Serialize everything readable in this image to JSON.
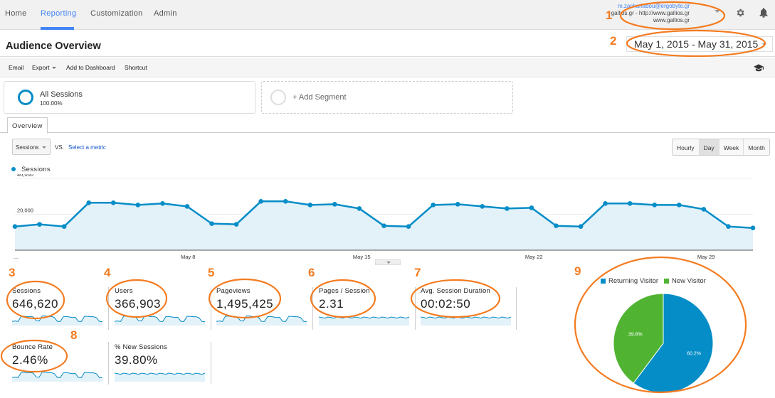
{
  "nav": {
    "tabs": [
      {
        "label": "Home",
        "active": false
      },
      {
        "label": "Reporting",
        "active": true
      },
      {
        "label": "Customization",
        "active": false
      },
      {
        "label": "Admin",
        "active": false
      }
    ],
    "account": {
      "email": "m.zachariadou@ergobyte.gr",
      "property": "gallios.gr - http://www.gallios.gr",
      "view": "www.gallios.gr"
    },
    "icons": [
      "gear-icon",
      "bell-icon"
    ]
  },
  "header": {
    "title": "Audience Overview",
    "date_range": "May 1, 2015 - May 31, 2015"
  },
  "toolbar": {
    "email": "Email",
    "export": "Export",
    "add_to_dashboard": "Add to Dashboard",
    "shortcut": "Shortcut"
  },
  "segments": {
    "all_label": "All Sessions",
    "all_pct": "100.00%",
    "add_label": "+ Add Segment"
  },
  "tabs": {
    "overview": "Overview"
  },
  "controls": {
    "metric": "Sessions",
    "vs": "VS.",
    "select_metric": "Select a metric",
    "granularity": [
      {
        "label": "Hourly",
        "active": false
      },
      {
        "label": "Day",
        "active": true
      },
      {
        "label": "Week",
        "active": false
      },
      {
        "label": "Month",
        "active": false
      }
    ]
  },
  "chart_data": [
    {
      "type": "area",
      "title": "",
      "legend": [
        "Sessions"
      ],
      "series_color": "#058dc7",
      "fill_color": "#e3f1f9",
      "ylim": [
        0,
        40000
      ],
      "yticks": [
        20000,
        40000
      ],
      "ytick_labels": [
        "20,000",
        "40,000"
      ],
      "xtick_labels": [
        {
          "index": 0,
          "label": "..."
        },
        {
          "index": 7,
          "label": "May 8"
        },
        {
          "index": 14,
          "label": "May 15"
        },
        {
          "index": 21,
          "label": "May 22"
        },
        {
          "index": 28,
          "label": "May 29"
        }
      ],
      "x": [
        "May 1",
        "May 2",
        "May 3",
        "May 4",
        "May 5",
        "May 6",
        "May 7",
        "May 8",
        "May 9",
        "May 10",
        "May 11",
        "May 12",
        "May 13",
        "May 14",
        "May 15",
        "May 16",
        "May 17",
        "May 18",
        "May 19",
        "May 20",
        "May 21",
        "May 22",
        "May 23",
        "May 24",
        "May 25",
        "May 26",
        "May 27",
        "May 28",
        "May 29",
        "May 30",
        "May 31"
      ],
      "series": [
        {
          "name": "Sessions",
          "values": [
            13200,
            14400,
            13200,
            26400,
            26400,
            25200,
            26000,
            24400,
            14800,
            14400,
            27200,
            27200,
            25200,
            25600,
            23200,
            13600,
            13200,
            25200,
            25600,
            24400,
            23200,
            23600,
            13600,
            13200,
            26000,
            26000,
            25200,
            25200,
            22800,
            13200,
            12400
          ]
        }
      ]
    },
    {
      "type": "pie",
      "legend": [
        "Returning Visitor",
        "New Visitor"
      ],
      "categories": [
        "Returning Visitor",
        "New Visitor"
      ],
      "values": [
        60.2,
        39.8
      ],
      "labels": [
        "60.2%",
        "39.8%"
      ],
      "colors": [
        "#058dc7",
        "#50b432"
      ]
    }
  ],
  "metrics": [
    {
      "label": "Sessions",
      "value": "646,620"
    },
    {
      "label": "Users",
      "value": "366,903"
    },
    {
      "label": "Pageviews",
      "value": "1,495,425"
    },
    {
      "label": "Pages / Session",
      "value": "2.31"
    },
    {
      "label": "Avg. Session Duration",
      "value": "00:02:50"
    },
    {
      "label": "Bounce Rate",
      "value": "2.46%"
    },
    {
      "label": "% New Sessions",
      "value": "39.80%"
    }
  ],
  "annotations": [
    "1",
    "2",
    "3",
    "4",
    "5",
    "6",
    "7",
    "8",
    "9"
  ]
}
